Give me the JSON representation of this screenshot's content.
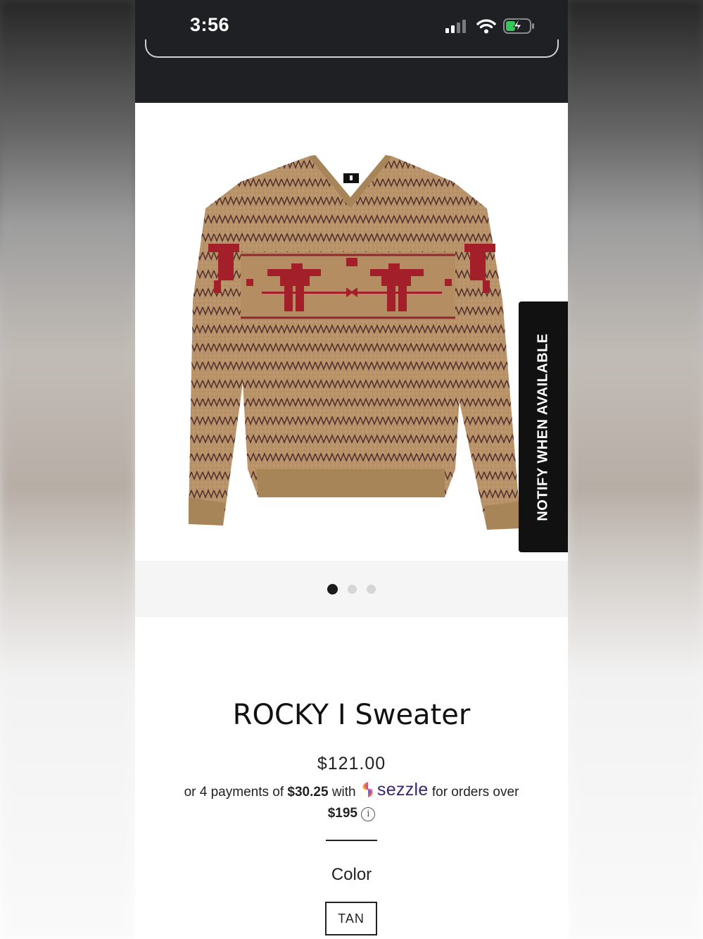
{
  "status_bar": {
    "time": "3:56",
    "signal_icon": "cellular-signal-icon",
    "wifi_icon": "wifi-icon",
    "battery_icon": "battery-charging-icon"
  },
  "product": {
    "name": "ROCKY I Sweater",
    "price": "$121.00",
    "image_alt": "tan v-neck sweater with red thunderbird pattern",
    "notify_label": "NOTIFY WHEN AVAILABLE",
    "carousel": {
      "count": 3,
      "active_index": 0
    }
  },
  "installments": {
    "prefix": "or 4 payments of",
    "amount": "$30.25",
    "with": "with",
    "provider": "sezzle",
    "suffix": "for orders over",
    "threshold": "$195",
    "info_icon": "info-icon"
  },
  "options": {
    "color_label": "Color",
    "selected_color": "TAN"
  },
  "colors": {
    "header_bg": "#1f2023",
    "sezzle_purple": "#3a2470",
    "sweater_tan": "#b9946a",
    "pattern_red": "#a3202a"
  }
}
